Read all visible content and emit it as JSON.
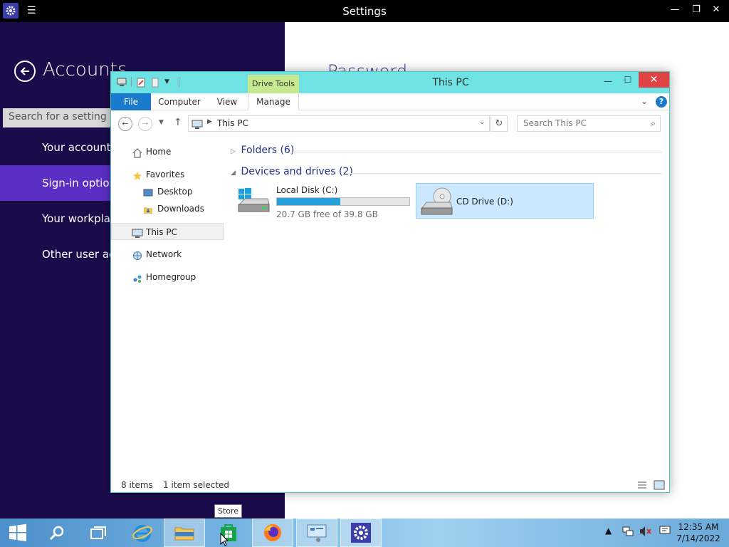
{
  "settings": {
    "window_title": "Settings",
    "section_title": "Accounts",
    "search_placeholder": "Search for a setting",
    "nav": [
      {
        "label": "Your account"
      },
      {
        "label": "Sign-in options"
      },
      {
        "label": "Your workplace"
      },
      {
        "label": "Other user accounts"
      }
    ],
    "right_heading": "Password",
    "accent": "#1b0b4b",
    "selected_color": "#5b2fc4"
  },
  "explorer": {
    "title": "This PC",
    "context_tab": "Drive Tools",
    "ribbon_tabs": [
      {
        "label": "File"
      },
      {
        "label": "Computer"
      },
      {
        "label": "View"
      },
      {
        "label": "Manage"
      }
    ],
    "address_path": "This PC",
    "search_placeholder": "Search This PC",
    "nav_items": [
      {
        "label": "Home",
        "icon": "home-icon"
      },
      {
        "label": "Favorites",
        "icon": "star-icon"
      },
      {
        "label": "Desktop",
        "icon": "desktop-icon"
      },
      {
        "label": "Downloads",
        "icon": "downloads-folder-icon"
      },
      {
        "label": "This PC",
        "icon": "computer-icon"
      },
      {
        "label": "Network",
        "icon": "network-icon"
      },
      {
        "label": "Homegroup",
        "icon": "homegroup-icon"
      }
    ],
    "groups": {
      "folders": "Folders (6)",
      "devices": "Devices and drives (2)"
    },
    "drives": [
      {
        "name": "Local Disk (C:)",
        "free_text": "20.7 GB free of 39.8 GB",
        "used_fraction": 0.48
      },
      {
        "name": "CD Drive (D:)"
      }
    ],
    "status": {
      "items": "8 items",
      "selected": "1 item selected"
    }
  },
  "tooltip": "Store",
  "taskbar": {
    "time": "12:35 AM",
    "date": "7/14/2022"
  }
}
